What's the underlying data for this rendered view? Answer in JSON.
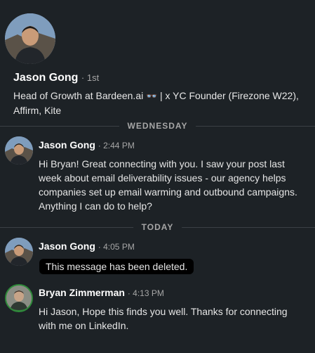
{
  "profile": {
    "name": "Jason Gong",
    "degree": "· 1st",
    "headline_part1": "Head of Growth at Bardeen.ai ",
    "headline_icon": "glasses-emoji-icon",
    "headline_part2": " | x YC Founder (Firezone W22), Affirm, Kite"
  },
  "dividers": {
    "wednesday": "WEDNESDAY",
    "today": "TODAY"
  },
  "messages": [
    {
      "sender": "Jason Gong",
      "time": "· 2:44 PM",
      "body": "Hi Bryan! Great connecting with you. I saw your post last week about email deliverability issues - our agency helps companies set up email warming and outbound campaigns. Anything I can do to help?"
    },
    {
      "sender": "Jason Gong",
      "time": "· 4:05 PM",
      "body": "This message has been deleted."
    },
    {
      "sender": "Bryan Zimmerman",
      "time": "· 4:13 PM",
      "body": "Hi Jason, Hope this finds you well. Thanks for connecting with me on LinkedIn."
    }
  ],
  "colors": {
    "background": "#1d2226",
    "divider": "#3b4045",
    "deleted_bg": "#000000"
  }
}
